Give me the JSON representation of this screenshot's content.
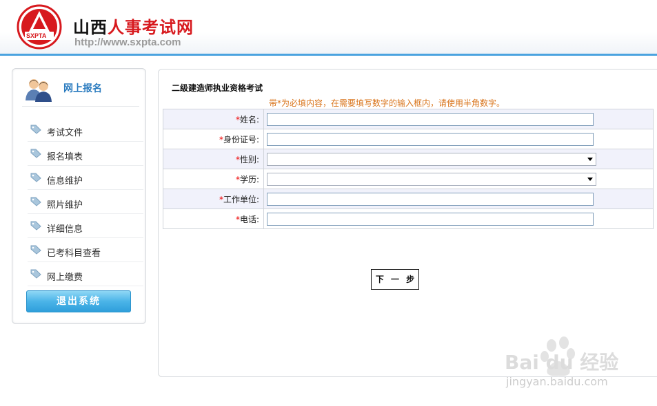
{
  "header": {
    "logo_text": "SXPTA",
    "title_part1": "山西",
    "title_part2": "人事考试网",
    "url": "http://www.sxpta.com"
  },
  "sidebar": {
    "title": "网上报名",
    "items": [
      {
        "label": "考试文件"
      },
      {
        "label": "报名填表"
      },
      {
        "label": "信息维护"
      },
      {
        "label": "照片维护"
      },
      {
        "label": "详细信息"
      },
      {
        "label": "已考科目查看"
      },
      {
        "label": "网上缴费"
      }
    ],
    "logout_label": "退出系统"
  },
  "main": {
    "title": "二级建造师执业资格考试",
    "notice": "带*为必填内容，在需要填写数字的输入框内，请使用半角数字。",
    "fields": [
      {
        "required": "*",
        "label": "姓名:",
        "type": "text",
        "value": ""
      },
      {
        "required": "*",
        "label": "身份证号:",
        "type": "text",
        "value": ""
      },
      {
        "required": "*",
        "label": "性别:",
        "type": "select",
        "value": ""
      },
      {
        "required": "*",
        "label": "学历:",
        "type": "select",
        "value": ""
      },
      {
        "required": "*",
        "label": "工作单位:",
        "type": "text",
        "value": ""
      },
      {
        "required": "*",
        "label": "电话:",
        "type": "text",
        "value": ""
      }
    ],
    "next_label": "下 一 步"
  },
  "watermark": {
    "brand": "Bai du 经验",
    "url": "jingyan.baidu.com"
  },
  "colors": {
    "accent_blue": "#4aa3df",
    "title_red": "#d7191e",
    "notice_orange": "#d9741b",
    "sidebar_title": "#2a7bbf",
    "required_red": "#ee0000"
  }
}
